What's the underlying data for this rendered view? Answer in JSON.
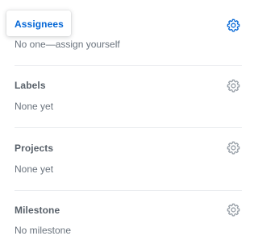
{
  "assignees": {
    "heading": "Assignees",
    "value": "No one—assign yourself",
    "gear_icon": "gear-icon",
    "heading_color": "#0366d6",
    "gear_color": "#0366d6"
  },
  "labels": {
    "heading": "Labels",
    "value": "None yet",
    "gear_icon": "gear-icon"
  },
  "projects": {
    "heading": "Projects",
    "value": "None yet",
    "gear_icon": "gear-icon"
  },
  "milestone": {
    "heading": "Milestone",
    "value": "No milestone",
    "gear_icon": "gear-icon"
  },
  "colors": {
    "muted_heading": "#586069",
    "muted_text": "#6a737d",
    "muted_gear": "#959da5",
    "divider": "#eaecef"
  }
}
